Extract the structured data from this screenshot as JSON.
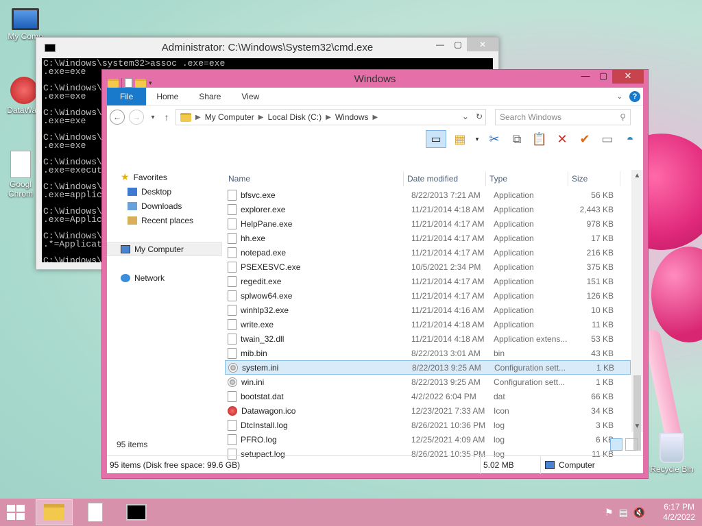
{
  "desktop": {
    "icons": [
      {
        "label": "My Comp"
      },
      {
        "label": "DataWag"
      },
      {
        "label": "Googl Chrom"
      },
      {
        "label": "Recycle Bin"
      }
    ]
  },
  "cmd": {
    "title": "Administrator: C:\\Windows\\System32\\cmd.exe",
    "lines": [
      "C:\\Windows\\system32>assoc .exe=exe",
      ".exe=exe",
      "",
      "C:\\Windows\\",
      ".exe=exe",
      "",
      "C:\\Windows\\",
      ".exe=exe",
      "",
      "C:\\Windows\\",
      ".exe=exe",
      "",
      "C:\\Windows\\",
      ".exe=execut",
      "",
      "C:\\Windows\\",
      ".exe=applic",
      "",
      "C:\\Windows\\",
      ".exe=Applic",
      "",
      "C:\\Windows\\",
      ".*=Applicat",
      "",
      "C:\\Windows\\"
    ]
  },
  "explorer": {
    "title": "Windows",
    "ribbon_tabs": [
      "File",
      "Home",
      "Share",
      "View"
    ],
    "address": {
      "parts": [
        "My Computer",
        "Local Disk (C:)",
        "Windows"
      ]
    },
    "search_placeholder": "Search Windows",
    "nav": {
      "favorites": "Favorites",
      "desktop": "Desktop",
      "downloads": "Downloads",
      "recent": "Recent places",
      "computer": "My Computer",
      "network": "Network"
    },
    "columns": {
      "name": "Name",
      "date": "Date modified",
      "type": "Type",
      "size": "Size"
    },
    "files": [
      {
        "name": "bfsvc.exe",
        "date": "8/22/2013 7:21 AM",
        "type": "Application",
        "size": "56 KB",
        "icon": "file"
      },
      {
        "name": "explorer.exe",
        "date": "11/21/2014 4:18 AM",
        "type": "Application",
        "size": "2,443 KB",
        "icon": "file"
      },
      {
        "name": "HelpPane.exe",
        "date": "11/21/2014 4:17 AM",
        "type": "Application",
        "size": "978 KB",
        "icon": "file"
      },
      {
        "name": "hh.exe",
        "date": "11/21/2014 4:17 AM",
        "type": "Application",
        "size": "17 KB",
        "icon": "file"
      },
      {
        "name": "notepad.exe",
        "date": "11/21/2014 4:17 AM",
        "type": "Application",
        "size": "216 KB",
        "icon": "file"
      },
      {
        "name": "PSEXESVC.exe",
        "date": "10/5/2021 2:34 PM",
        "type": "Application",
        "size": "375 KB",
        "icon": "file"
      },
      {
        "name": "regedit.exe",
        "date": "11/21/2014 4:17 AM",
        "type": "Application",
        "size": "151 KB",
        "icon": "file"
      },
      {
        "name": "splwow64.exe",
        "date": "11/21/2014 4:17 AM",
        "type": "Application",
        "size": "126 KB",
        "icon": "file"
      },
      {
        "name": "winhlp32.exe",
        "date": "11/21/2014 4:16 AM",
        "type": "Application",
        "size": "10 KB",
        "icon": "file"
      },
      {
        "name": "write.exe",
        "date": "11/21/2014 4:18 AM",
        "type": "Application",
        "size": "11 KB",
        "icon": "file"
      },
      {
        "name": "twain_32.dll",
        "date": "11/21/2014 4:18 AM",
        "type": "Application extens...",
        "size": "53 KB",
        "icon": "file"
      },
      {
        "name": "mib.bin",
        "date": "8/22/2013 3:01 AM",
        "type": "bin",
        "size": "43 KB",
        "icon": "file"
      },
      {
        "name": "system.ini",
        "date": "8/22/2013 9:25 AM",
        "type": "Configuration sett...",
        "size": "1 KB",
        "icon": "gear"
      },
      {
        "name": "win.ini",
        "date": "8/22/2013 9:25 AM",
        "type": "Configuration sett...",
        "size": "1 KB",
        "icon": "gear"
      },
      {
        "name": "bootstat.dat",
        "date": "4/2/2022 6:04 PM",
        "type": "dat",
        "size": "66 KB",
        "icon": "file"
      },
      {
        "name": "Datawagon.ico",
        "date": "12/23/2021 7:33 AM",
        "type": "Icon",
        "size": "34 KB",
        "icon": "ico"
      },
      {
        "name": "DtcInstall.log",
        "date": "8/26/2021 10:36 PM",
        "type": "log",
        "size": "3 KB",
        "icon": "file"
      },
      {
        "name": "PFRO.log",
        "date": "12/25/2021 4:09 AM",
        "type": "log",
        "size": "6 KB",
        "icon": "file"
      },
      {
        "name": "setupact.log",
        "date": "8/26/2021 10:35 PM",
        "type": "log",
        "size": "11 KB",
        "icon": "file"
      }
    ],
    "item_count": "95 items",
    "status": {
      "left": "95 items (Disk free space: 99.6 GB)",
      "size": "5.02 MB",
      "location": "Computer"
    }
  },
  "taskbar": {
    "time": "6:17 PM",
    "date": "4/2/2022"
  }
}
